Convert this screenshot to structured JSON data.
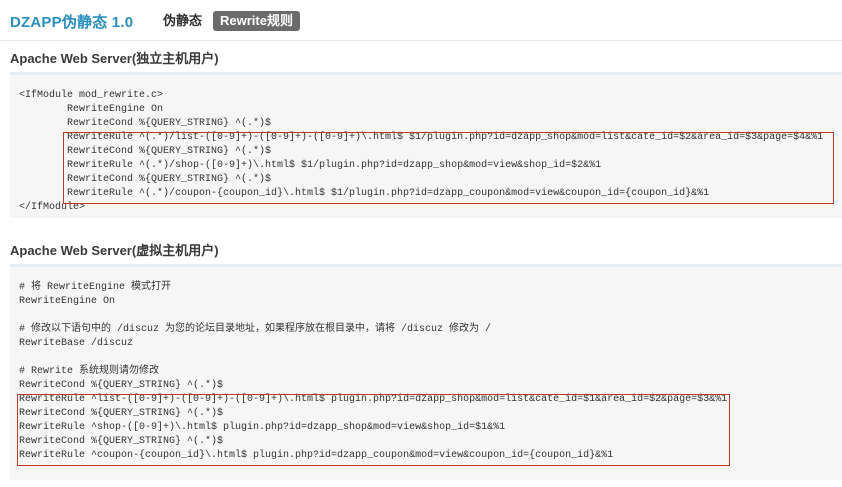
{
  "header": {
    "app_title": "DZAPP伪静态 1.0",
    "tabs": [
      {
        "label": "伪静态",
        "active": false
      },
      {
        "label": "Rewrite规则",
        "active": true
      }
    ]
  },
  "sections": [
    {
      "title": "Apache Web Server(独立主机用户)",
      "lines": [
        "<IfModule mod_rewrite.c>",
        "RewriteEngine On",
        "RewriteCond %{QUERY_STRING} ^(.*)$",
        "RewriteRule ^(.*)/list-([0-9]+)-([0-9]+)-([0-9]+)\\.html$ $1/plugin.php?id=dzapp_shop&mod=list&cate_id=$2&area_id=$3&page=$4&%1",
        "RewriteCond %{QUERY_STRING} ^(.*)$",
        "RewriteRule ^(.*)/shop-([0-9]+)\\.html$ $1/plugin.php?id=dzapp_shop&mod=view&shop_id=$2&%1",
        "RewriteCond %{QUERY_STRING} ^(.*)$",
        "RewriteRule ^(.*)/coupon-{coupon_id}\\.html$ $1/plugin.php?id=dzapp_coupon&mod=view&coupon_id={coupon_id}&%1",
        "</IfModule>"
      ]
    },
    {
      "title": "Apache Web Server(虚拟主机用户)",
      "lines": [
        "# 将 RewriteEngine 模式打开",
        "RewriteEngine On",
        "",
        "# 修改以下语句中的 /discuz 为您的论坛目录地址，如果程序放在根目录中，请将 /discuz 修改为 /",
        "RewriteBase /discuz",
        "",
        "# Rewrite 系统规则请勿修改",
        "RewriteCond %{QUERY_STRING} ^(.*)$",
        "RewriteRule ^list-([0-9]+)-([0-9]+)-([0-9]+)\\.html$ plugin.php?id=dzapp_shop&mod=list&cate_id=$1&area_id=$2&page=$3&%1",
        "RewriteCond %{QUERY_STRING} ^(.*)$",
        "RewriteRule ^shop-([0-9]+)\\.html$ plugin.php?id=dzapp_shop&mod=view&shop_id=$1&%1",
        "RewriteCond %{QUERY_STRING} ^(.*)$",
        "RewriteRule ^coupon-{coupon_id}\\.html$ plugin.php?id=dzapp_coupon&mod=view&coupon_id={coupon_id}&%1"
      ]
    }
  ],
  "colors": {
    "title_accent": "#2a8fbd",
    "active_tab_bg": "#6b6b6b",
    "highlight_border": "#c0392b",
    "code_bg": "#f6f6f6"
  }
}
